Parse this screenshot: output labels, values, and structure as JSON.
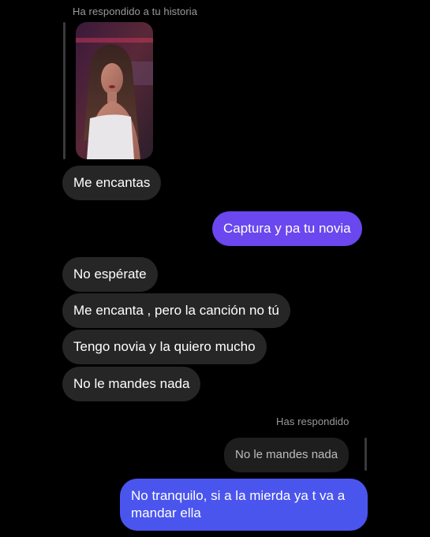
{
  "story_reply": {
    "label": "Ha respondido a tu historia",
    "thumbnail_subject": "story-photo-woman"
  },
  "messages": [
    {
      "text": "Me encantas",
      "direction": "incoming"
    },
    {
      "text": "Captura y pa tu novia",
      "direction": "outgoing"
    },
    {
      "text": "No espérate",
      "direction": "incoming"
    },
    {
      "text": "Me encanta , pero la canción no tú",
      "direction": "incoming"
    },
    {
      "text": "Tengo novia y la quiero mucho",
      "direction": "incoming"
    },
    {
      "text": "No le mandes nada",
      "direction": "incoming"
    }
  ],
  "my_reply": {
    "label": "Has respondido",
    "quoted_text": "No le mandes nada",
    "text": "No tranquilo, si a la mierda ya t va a mandar ella"
  },
  "colors": {
    "background": "#000000",
    "incoming_bubble": "#262626",
    "outgoing_bubble_purple": "#6a47ee",
    "outgoing_bubble_blue": "#4a55ee",
    "label_gray": "#9a9a9a"
  }
}
